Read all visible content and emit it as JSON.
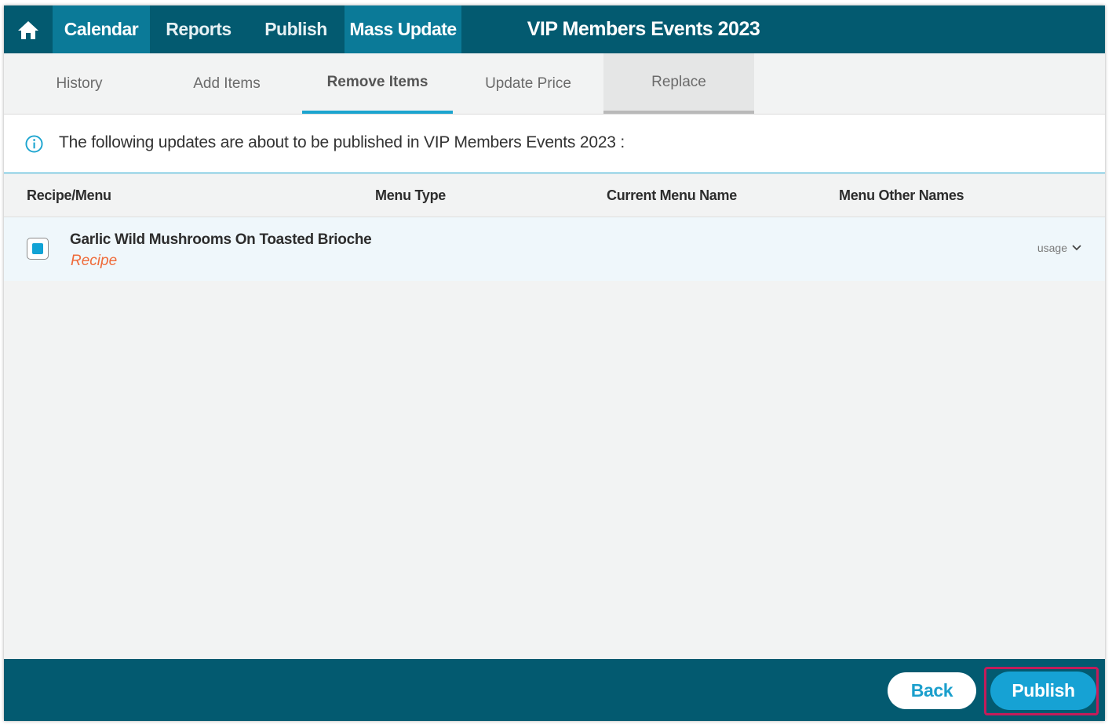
{
  "topnav": {
    "home_icon": "home-icon",
    "items": [
      {
        "label": "Calendar",
        "active": true
      },
      {
        "label": "Reports",
        "active": false
      },
      {
        "label": "Publish",
        "active": false
      },
      {
        "label": "Mass Update",
        "active": true
      }
    ],
    "title": "VIP Members Events 2023"
  },
  "subtabs": [
    {
      "label": "History"
    },
    {
      "label": "Add Items"
    },
    {
      "label": "Remove Items",
      "state": "selected"
    },
    {
      "label": "Update Price"
    },
    {
      "label": "Replace",
      "state": "hover"
    }
  ],
  "info": {
    "icon": "info-icon",
    "text": "The following updates are about to be published in VIP Members Events 2023 :"
  },
  "table": {
    "columns": [
      "Recipe/Menu",
      "Menu Type",
      "Current Menu Name",
      "Menu Other Names"
    ],
    "rows": [
      {
        "checked": true,
        "name": "Garlic Wild Mushrooms On Toasted Brioche",
        "type": "Recipe",
        "usage_label": "usage"
      }
    ]
  },
  "footer": {
    "back_label": "Back",
    "publish_label": "Publish"
  },
  "colors": {
    "nav_bg": "#035a70",
    "nav_active": "#0b7a98",
    "accent": "#1ba4cf",
    "recipe_type": "#ef6b3a",
    "highlight": "#c41c5a"
  }
}
